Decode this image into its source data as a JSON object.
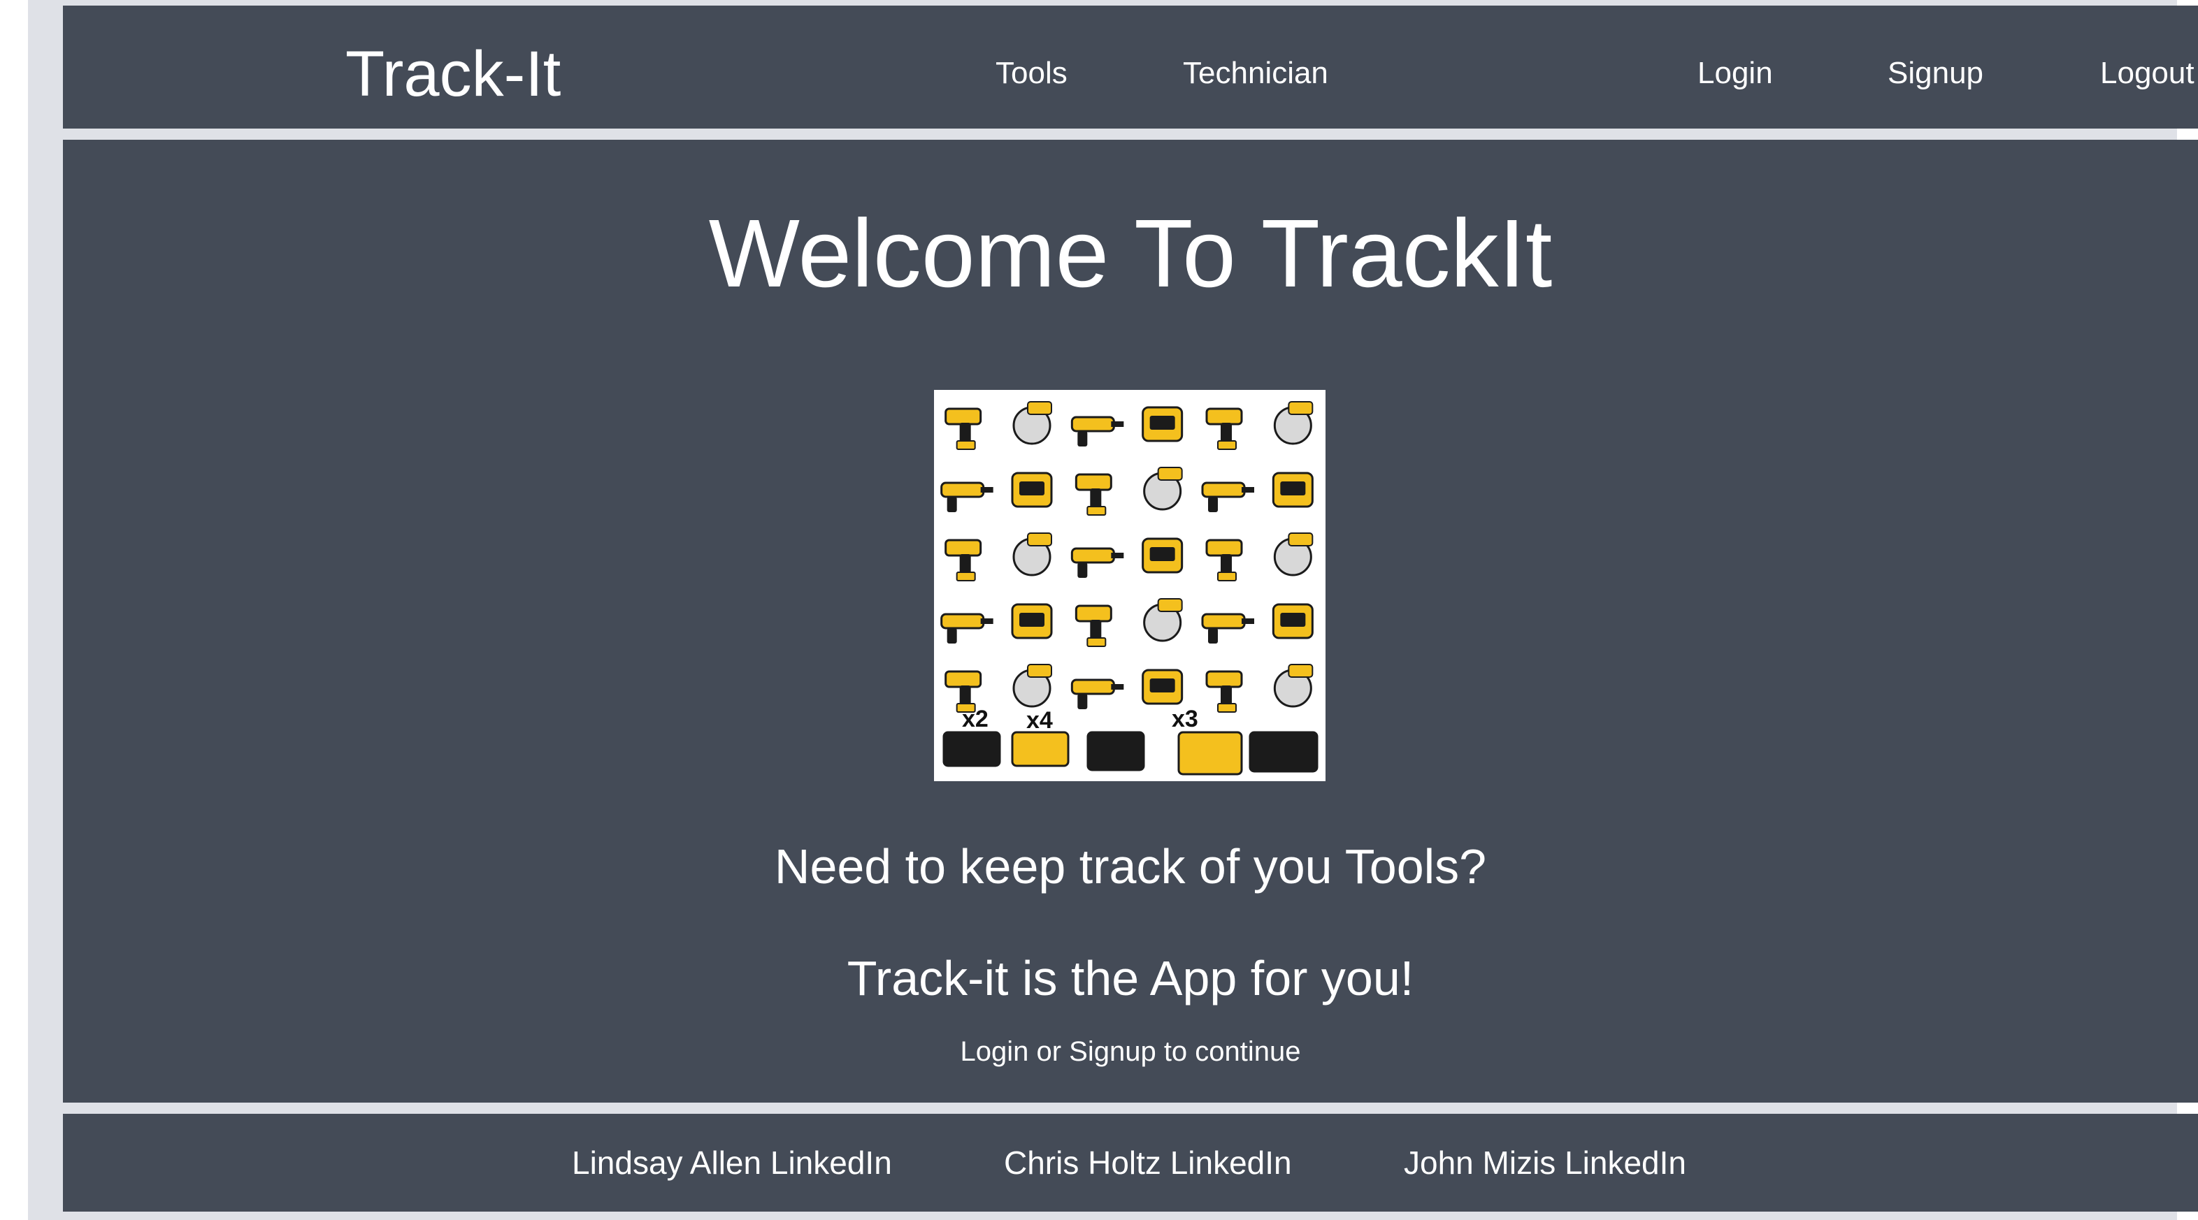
{
  "header": {
    "brand": "Track-It",
    "nav": {
      "tools": "Tools",
      "technician": "Technician",
      "login": "Login",
      "signup": "Signup",
      "logout": "Logout"
    }
  },
  "hero": {
    "title": "Welcome To TrackIt",
    "image": {
      "labels": [
        "x2",
        "x4",
        "x3"
      ]
    },
    "question": "Need to keep track of you Tools?",
    "answer": "Track-it is the App for you!",
    "cta": "Login or Signup to continue"
  },
  "footer": {
    "links": [
      "Lindsay Allen LinkedIn",
      "Chris Holtz LinkedIn",
      "John Mizis LinkedIn"
    ]
  },
  "colors": {
    "panel": "#444b57",
    "frame": "#dfe1e7",
    "text": "#ffffff",
    "tool_yellow": "#f4c01e",
    "tool_black": "#1b1b1b"
  }
}
